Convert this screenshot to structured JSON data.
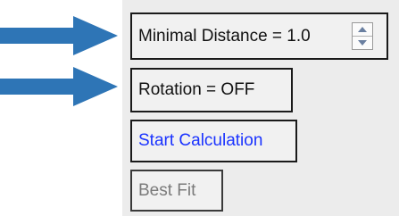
{
  "controls": {
    "minimal_distance_label": "Minimal Distance = 1.0",
    "rotation_label": "Rotation = OFF",
    "start_calculation_label": "Start Calculation",
    "best_fit_label": "Best Fit"
  },
  "icons": {
    "pointer_arrows": "arrow-right-icon",
    "spinner_up": "chevron-up-icon",
    "spinner_down": "chevron-down-icon"
  },
  "colors": {
    "arrow": "#2e75b6",
    "link_text": "#1a33ff",
    "disabled_text": "#7a7a7a",
    "panel_background": "#ececec"
  }
}
